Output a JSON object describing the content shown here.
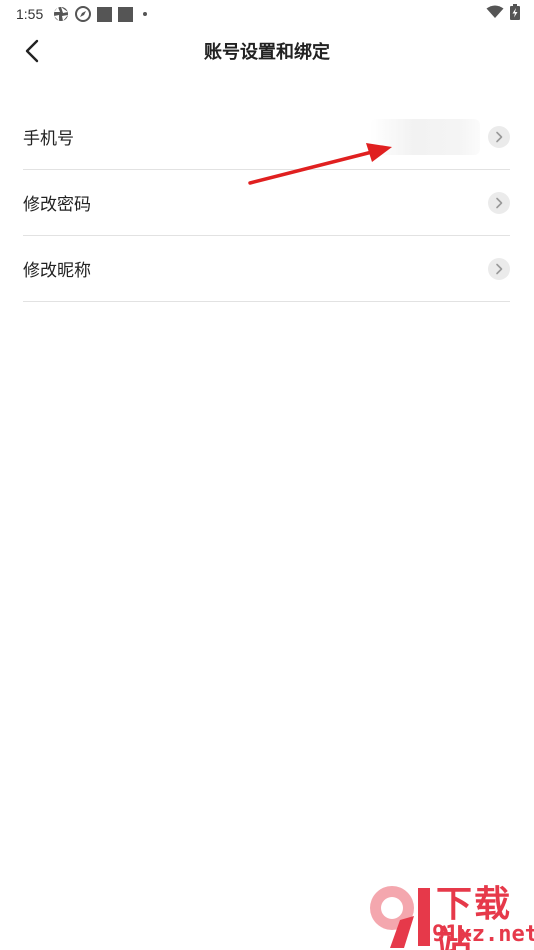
{
  "status_bar": {
    "time": "1:55"
  },
  "header": {
    "title": "账号设置和绑定"
  },
  "settings": {
    "items": [
      {
        "label": "手机号"
      },
      {
        "label": "修改密码"
      },
      {
        "label": "修改昵称"
      }
    ]
  },
  "watermark": {
    "brand_cn": "下载站",
    "domain": "91xz.net"
  },
  "colors": {
    "accent_red": "#e02020",
    "watermark_red": "#e6394a",
    "divider": "#e2e2e2"
  }
}
